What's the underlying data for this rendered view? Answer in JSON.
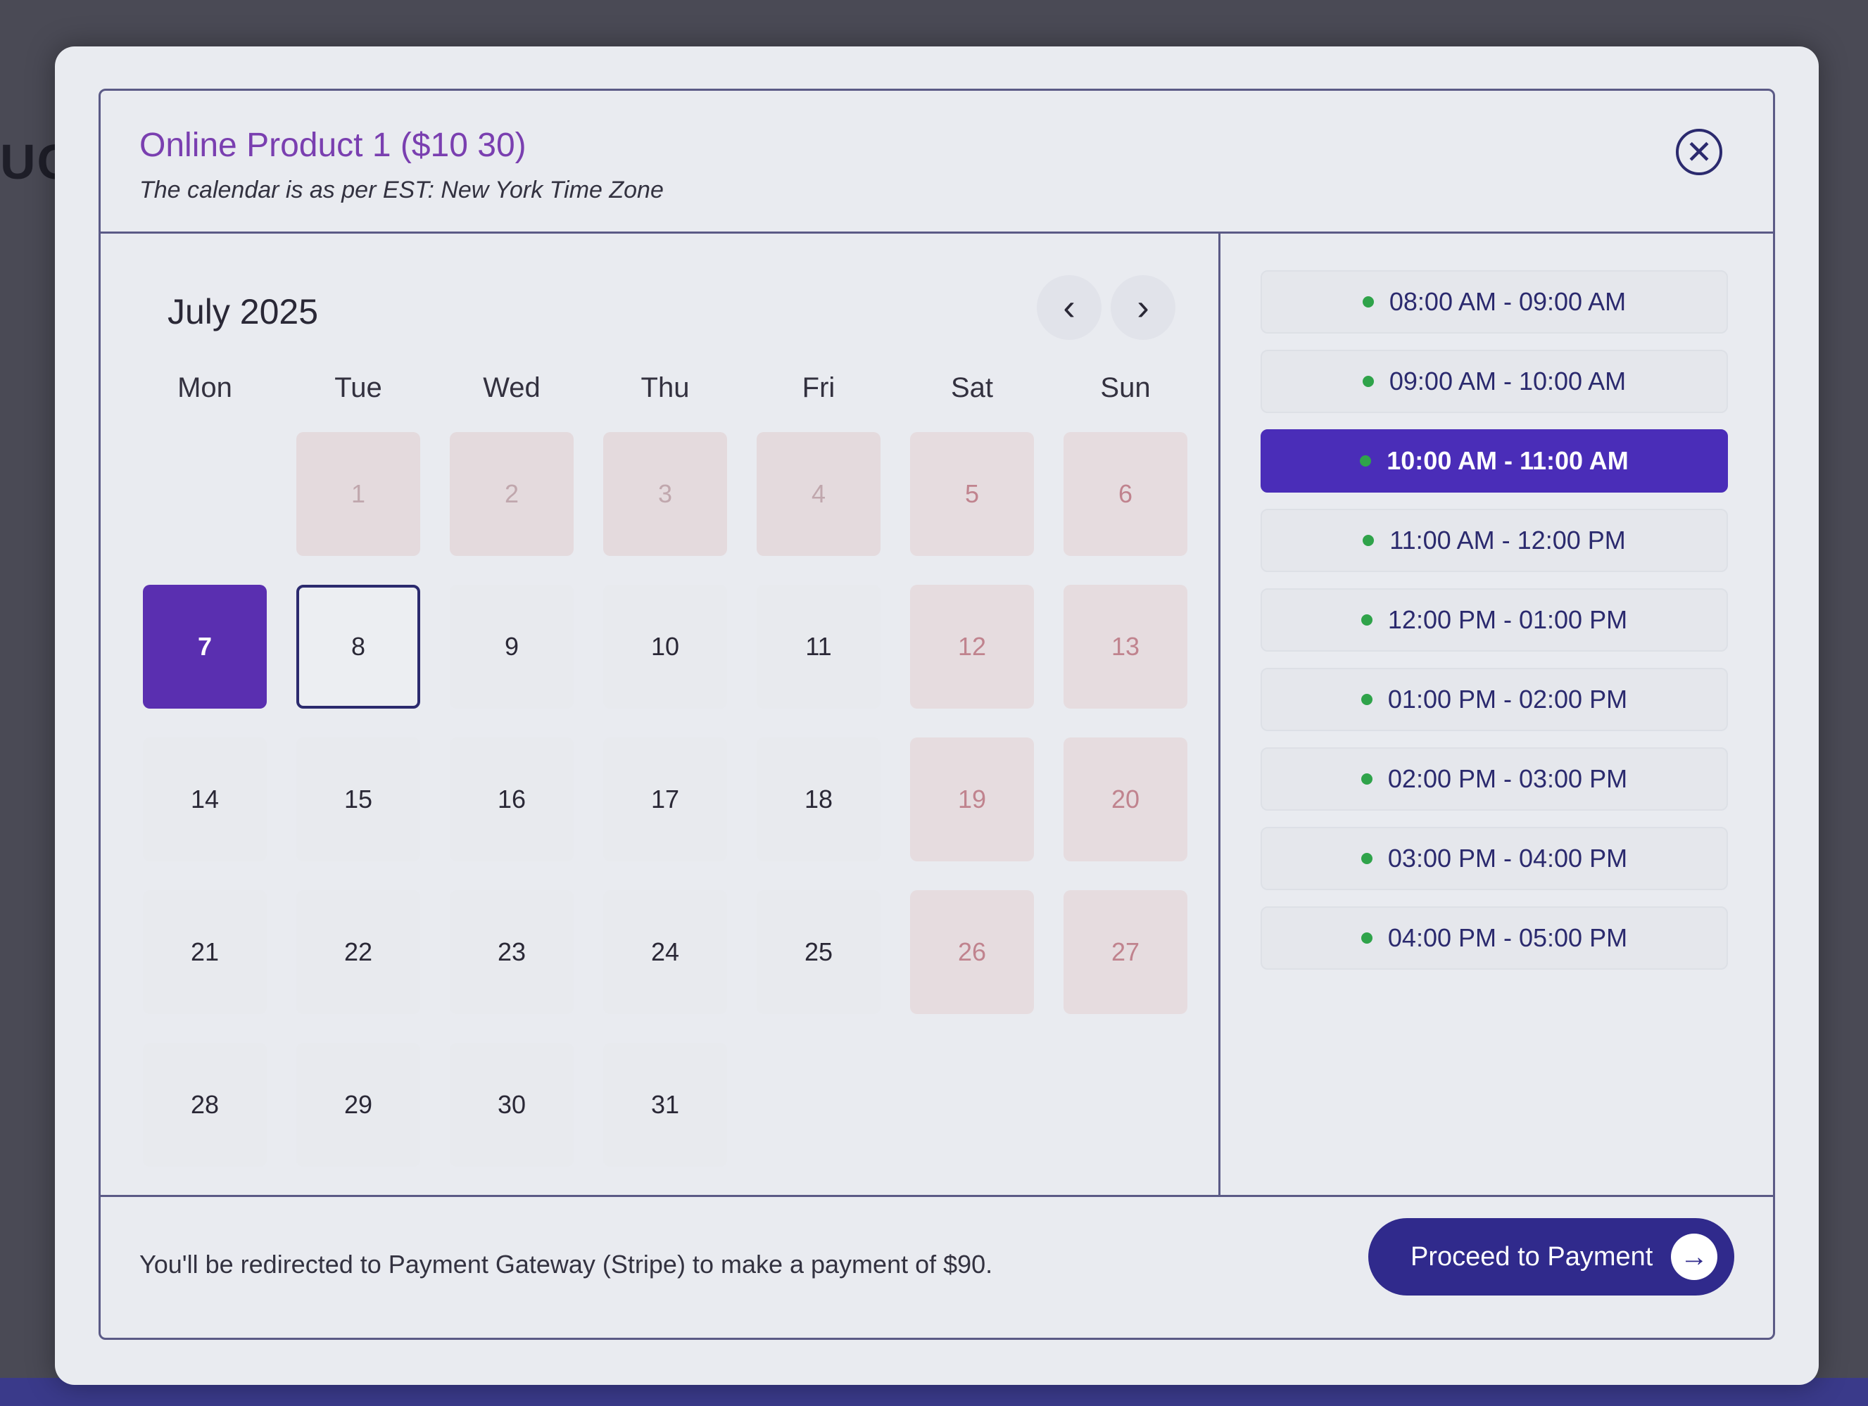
{
  "background": {
    "partial_text": "UC"
  },
  "modal": {
    "title": "Online Product 1 ($10 30)",
    "subtitle": "The calendar is as per EST: New York Time Zone",
    "close_icon": "close-icon"
  },
  "calendar": {
    "month": "July 2025",
    "prev_icon": "chevron-left-icon",
    "next_icon": "chevron-right-icon",
    "prev_glyph": "‹",
    "next_glyph": "›",
    "weekdays": [
      "Mon",
      "Tue",
      "Wed",
      "Thu",
      "Fri",
      "Sat",
      "Sun"
    ],
    "days": [
      "1",
      "2",
      "3",
      "4",
      "5",
      "6",
      "7",
      "8",
      "9",
      "10",
      "11",
      "12",
      "13",
      "14",
      "15",
      "16",
      "17",
      "18",
      "19",
      "20",
      "21",
      "22",
      "23",
      "24",
      "25",
      "26",
      "27",
      "28",
      "29",
      "30",
      "31"
    ],
    "selected_day": "7",
    "today_day": "8"
  },
  "time_slots": [
    "08:00 AM - 09:00 AM",
    "09:00 AM - 10:00 AM",
    "10:00 AM - 11:00 AM",
    "11:00 AM - 12:00 PM",
    "12:00 PM - 01:00 PM",
    "01:00 PM - 02:00 PM",
    "02:00 PM - 03:00 PM",
    "03:00 PM - 04:00 PM",
    "04:00 PM - 05:00 PM"
  ],
  "selected_slot": "10:00 AM - 11:00 AM",
  "footer": {
    "note": "You'll be redirected to Payment Gateway (Stripe) to make a payment of $90.",
    "button_label": "Proceed to Payment",
    "button_icon": "arrow-right-icon",
    "button_glyph": "→"
  },
  "colors": {
    "accent": "#4a2db8",
    "title": "#7a3fb0",
    "available_dot": "#2fa34a",
    "weekend_text": "#c0838e"
  }
}
